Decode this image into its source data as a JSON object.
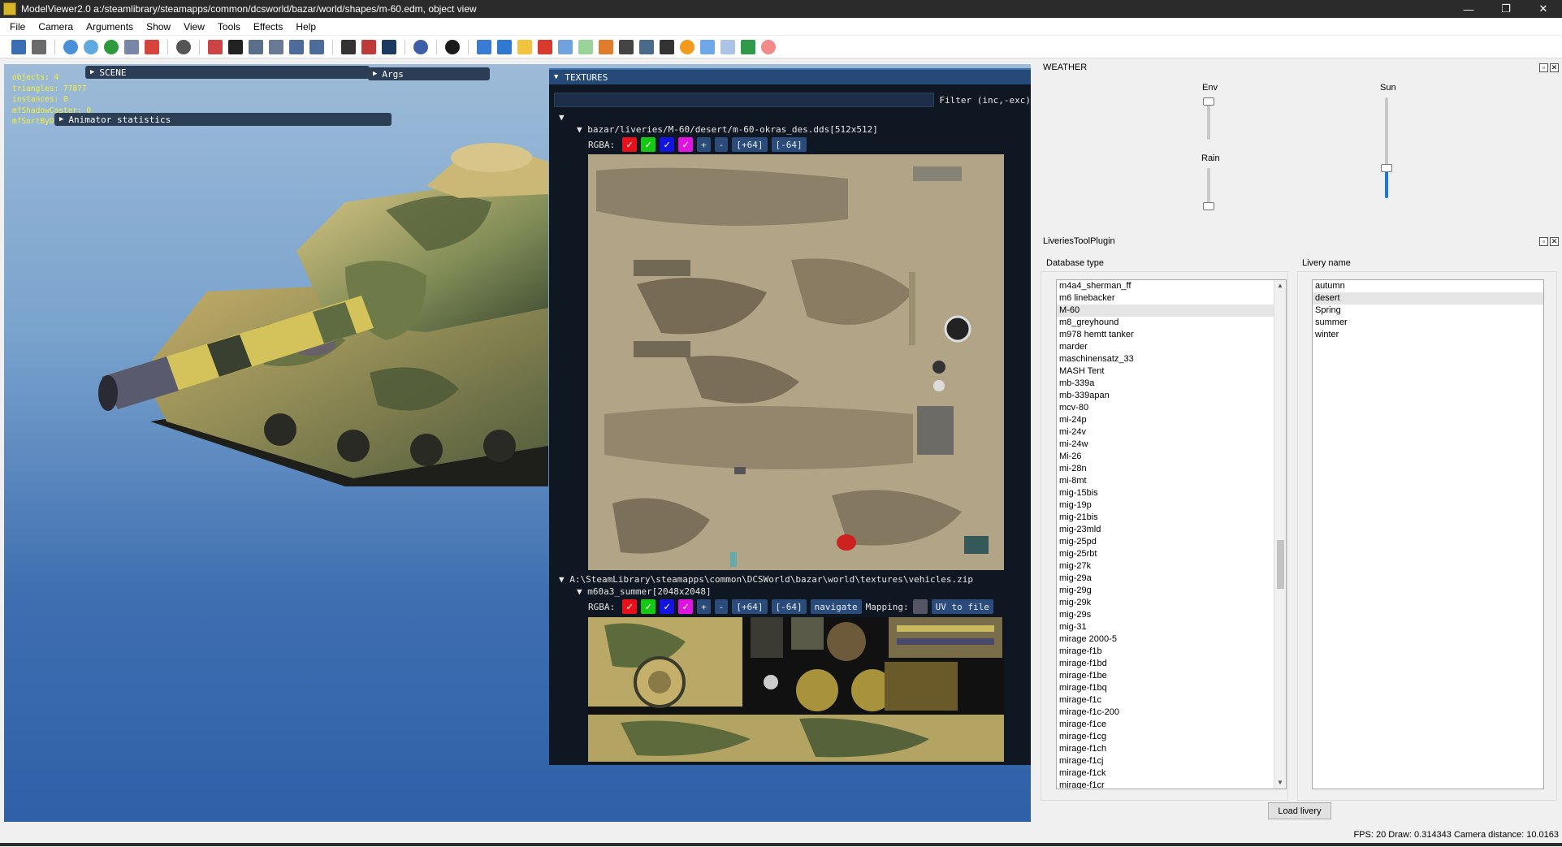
{
  "window": {
    "title": "ModelViewer2.0 a:/steamlibrary/steamapps/common/dcsworld/bazar/world/shapes/m-60.edm, object view",
    "minimize": "—",
    "maximize": "❐",
    "close": "✕"
  },
  "menu": [
    "File",
    "Camera",
    "Arguments",
    "Show",
    "View",
    "Tools",
    "Effects",
    "Help"
  ],
  "viewport": {
    "stats": [
      "objects: 4",
      "triangles: 77877",
      "instances: 0",
      "mfShadowCaster: 0",
      "mfSortByD"
    ],
    "scene_label": "SCENE",
    "args_label": "Args",
    "animator_label": "Animator statistics"
  },
  "textures": {
    "header": "TEXTURES",
    "filter_label": "Filter (inc,-exc)",
    "file1": "bazar/liveries/M-60/desert/m-60-okras_des.dds[512x512]",
    "rgba_label": "RGBA:",
    "plus": "+",
    "minus": "-",
    "plus64": "[+64]",
    "minus64": "[-64]",
    "archive": "A:\\SteamLibrary\\steamapps\\common\\DCSWorld\\bazar\\world\\textures\\vehicles.zip",
    "file2": "m60a3_summer[2048x2048]",
    "navigate": "navigate",
    "mapping_label": "Mapping:",
    "uv_to_file": "UV to file"
  },
  "weather": {
    "title": "WEATHER",
    "env_label": "Env",
    "sun_label": "Sun",
    "rain_label": "Rain",
    "env_value": 1.0,
    "sun_value": 0.3,
    "rain_value": 0.0
  },
  "liveries": {
    "title": "LiveriesToolPlugin",
    "database_label": "Database type",
    "livery_label": "Livery name",
    "database_items": [
      "m4a4_sherman_ff",
      "m6 linebacker",
      "M-60",
      "m8_greyhound",
      "m978 hemtt tanker",
      "marder",
      "maschinensatz_33",
      "MASH Tent",
      "mb-339a",
      "mb-339apan",
      "mcv-80",
      "mi-24p",
      "mi-24v",
      "mi-24w",
      "Mi-26",
      "mi-28n",
      "mi-8mt",
      "mig-15bis",
      "mig-19p",
      "mig-21bis",
      "mig-23mld",
      "mig-25pd",
      "mig-25rbt",
      "mig-27k",
      "mig-29a",
      "mig-29g",
      "mig-29k",
      "mig-29s",
      "mig-31",
      "mirage 2000-5",
      "mirage-f1b",
      "mirage-f1bd",
      "mirage-f1be",
      "mirage-f1bq",
      "mirage-f1c",
      "mirage-f1c-200",
      "mirage-f1ce",
      "mirage-f1cg",
      "mirage-f1ch",
      "mirage-f1cj",
      "mirage-f1ck",
      "mirage-f1cr"
    ],
    "database_selected": "M-60",
    "livery_items": [
      "autumn",
      "desert",
      "Spring",
      "summer",
      "winter"
    ],
    "livery_selected": "desert",
    "load_button": "Load livery"
  },
  "status": {
    "text": "FPS: 20  Draw: 0.314343  Camera distance: 10.0163"
  }
}
